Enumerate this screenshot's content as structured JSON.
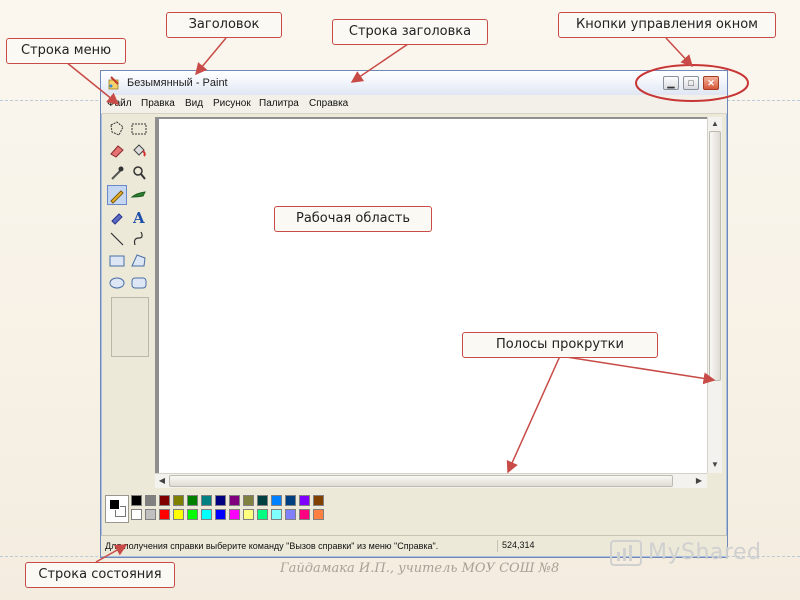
{
  "window": {
    "title": "Безымянный - Paint",
    "controls": [
      "minimize",
      "maximize",
      "close"
    ]
  },
  "menu": {
    "items": [
      "Файл",
      "Правка",
      "Вид",
      "Рисунок",
      "Палитра",
      "Справка"
    ]
  },
  "tools": [
    {
      "name": "free-select-icon"
    },
    {
      "name": "rect-select-icon"
    },
    {
      "name": "eraser-icon"
    },
    {
      "name": "fill-icon"
    },
    {
      "name": "color-picker-icon"
    },
    {
      "name": "magnifier-icon"
    },
    {
      "name": "pencil-icon",
      "active": true
    },
    {
      "name": "brush-icon"
    },
    {
      "name": "airbrush-icon"
    },
    {
      "name": "text-icon"
    },
    {
      "name": "line-icon"
    },
    {
      "name": "curve-icon"
    },
    {
      "name": "rectangle-icon"
    },
    {
      "name": "polygon-icon"
    },
    {
      "name": "ellipse-icon"
    },
    {
      "name": "rounded-rect-icon"
    }
  ],
  "palette": {
    "top_row": [
      "#000000",
      "#808080",
      "#800000",
      "#808000",
      "#008000",
      "#008080",
      "#000080",
      "#800080",
      "#808040",
      "#004040",
      "#0080ff",
      "#004080",
      "#8000ff",
      "#804000"
    ],
    "bottom_row": [
      "#ffffff",
      "#c0c0c0",
      "#ff0000",
      "#ffff00",
      "#00ff00",
      "#00ffff",
      "#0000ff",
      "#ff00ff",
      "#ffff80",
      "#00ff80",
      "#80ffff",
      "#8080ff",
      "#ff0080",
      "#ff8040"
    ]
  },
  "status": {
    "help_text": "Для получения справки выберите команду \"Вызов справки\" из меню \"Справка\".",
    "coords": "524,314"
  },
  "callouts": {
    "title": "Заголовок",
    "title_bar": "Строка заголовка",
    "window_buttons": "Кнопки управления окном",
    "menu_bar": "Строка меню",
    "work_area": "Рабочая область",
    "scrollbars": "Полосы прокрутки",
    "status_bar": "Строка состояния"
  },
  "footer": "Гайдамака И.П., учитель МОУ СОШ №8",
  "watermark": "MyShared",
  "colors": {
    "callout_border": "#c84b47",
    "arrow": "#c84b47",
    "highlight_ellipse": "#c83535"
  }
}
